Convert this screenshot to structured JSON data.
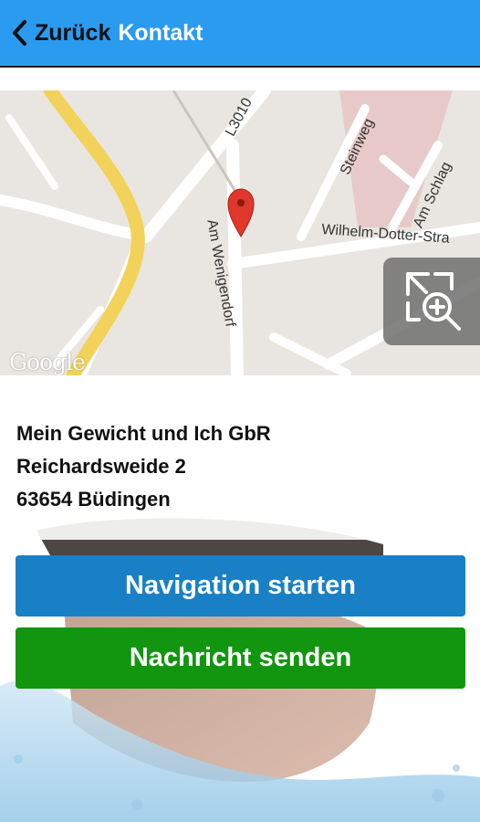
{
  "header": {
    "back_label": "Zurück",
    "title": "Kontakt",
    "background": "#2b9bf0"
  },
  "map": {
    "streets": [
      "L3010",
      "Steinweg",
      "Am Schlag",
      "Wilhelm-Dotter-Stra",
      "Am Wenigendorf"
    ],
    "logo": "Google",
    "marker_color": "#e0362b"
  },
  "address": {
    "name": "Mein Gewicht und Ich GbR",
    "street": "Reichardsweide 2",
    "city": "63654 Büdingen"
  },
  "buttons": {
    "navigation": "Navigation starten",
    "message": "Nachricht senden",
    "navigation_color": "#1a80c5",
    "message_color": "#12960f"
  }
}
